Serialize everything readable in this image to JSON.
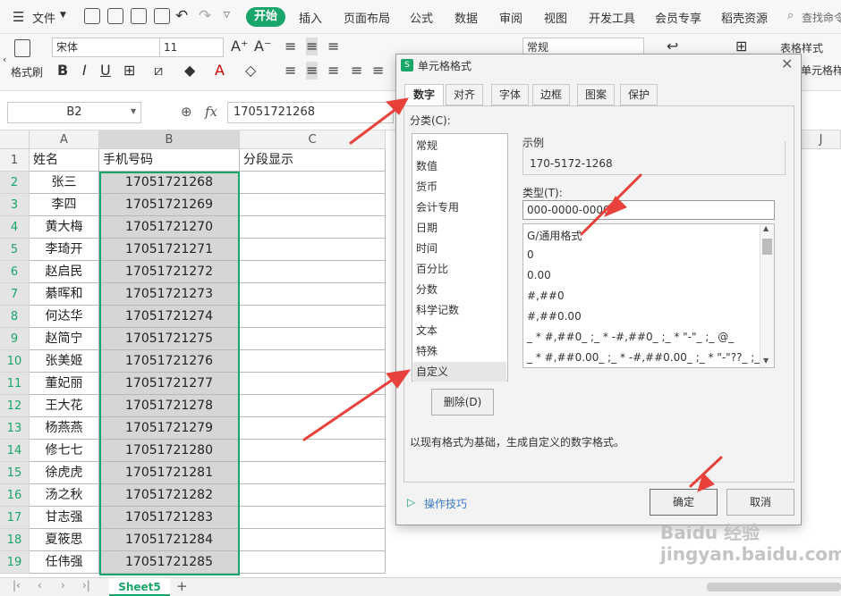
{
  "menubar": {
    "file": "文件",
    "tabs": [
      "开始",
      "插入",
      "页面布局",
      "公式",
      "数据",
      "审阅",
      "视图",
      "开发工具",
      "会员专享",
      "稻壳资源"
    ],
    "search": "查找命令"
  },
  "ribbon": {
    "paste_label": "格式刷",
    "font_name": "宋体",
    "font_size": "11",
    "number_format": "常规",
    "table_style": "表格样式",
    "cell_style": "单元格样"
  },
  "formula": {
    "namebox": "B2",
    "fx": "fx",
    "value": "17051721268"
  },
  "grid": {
    "columns": [
      "A",
      "B",
      "C",
      "J"
    ],
    "header_row": {
      "a": "姓名",
      "b": "手机号码",
      "c": "分段显示"
    },
    "rows": [
      {
        "num": "2",
        "name": "张三",
        "phone": "17051721268"
      },
      {
        "num": "3",
        "name": "李四",
        "phone": "17051721269"
      },
      {
        "num": "4",
        "name": "黄大梅",
        "phone": "17051721270"
      },
      {
        "num": "5",
        "name": "李琦开",
        "phone": "17051721271"
      },
      {
        "num": "6",
        "name": "赵启民",
        "phone": "17051721272"
      },
      {
        "num": "7",
        "name": "綦晖和",
        "phone": "17051721273"
      },
      {
        "num": "8",
        "name": "何达华",
        "phone": "17051721274"
      },
      {
        "num": "9",
        "name": "赵简宁",
        "phone": "17051721275"
      },
      {
        "num": "10",
        "name": "张美姬",
        "phone": "17051721276"
      },
      {
        "num": "11",
        "name": "董妃丽",
        "phone": "17051721277"
      },
      {
        "num": "12",
        "name": "王大花",
        "phone": "17051721278"
      },
      {
        "num": "13",
        "name": "杨燕燕",
        "phone": "17051721279"
      },
      {
        "num": "14",
        "name": "修七七",
        "phone": "17051721280"
      },
      {
        "num": "15",
        "name": "徐虎虎",
        "phone": "17051721281"
      },
      {
        "num": "16",
        "name": "汤之秋",
        "phone": "17051721282"
      },
      {
        "num": "17",
        "name": "甘志强",
        "phone": "17051721283"
      },
      {
        "num": "18",
        "name": "夏筱思",
        "phone": "17051721284"
      },
      {
        "num": "19",
        "name": "任伟强",
        "phone": "17051721285"
      }
    ]
  },
  "sheet_tab": "Sheet5",
  "dialog": {
    "title": "单元格格式",
    "tabs": [
      "数字",
      "对齐",
      "字体",
      "边框",
      "图案",
      "保护"
    ],
    "category_label": "分类(C):",
    "categories": [
      "常规",
      "数值",
      "货币",
      "会计专用",
      "日期",
      "时间",
      "百分比",
      "分数",
      "科学记数",
      "文本",
      "特殊",
      "自定义"
    ],
    "sample_label": "示例",
    "sample_value": "170-5172-1268",
    "type_label": "类型(T):",
    "type_value": "000-0000-0000",
    "type_list": [
      "G/通用格式",
      "0",
      "0.00",
      "#,##0",
      "#,##0.00",
      "_ * #,##0_ ;_ * -#,##0_ ;_ * \"-\"_ ;_ @_",
      "_ * #,##0.00_ ;_ * -#,##0.00_ ;_ * \"-\"??_ ;_ @_"
    ],
    "delete_label": "删除(D)",
    "description": "以现有格式为基础，生成自定义的数字格式。",
    "tips_label": "操作技巧",
    "ok_label": "确定",
    "cancel_label": "取消"
  },
  "watermark": "Baidu 经验  jingyan.baidu.com",
  "colors": {
    "accent": "#1aa56a",
    "arrow": "#e8413c"
  }
}
